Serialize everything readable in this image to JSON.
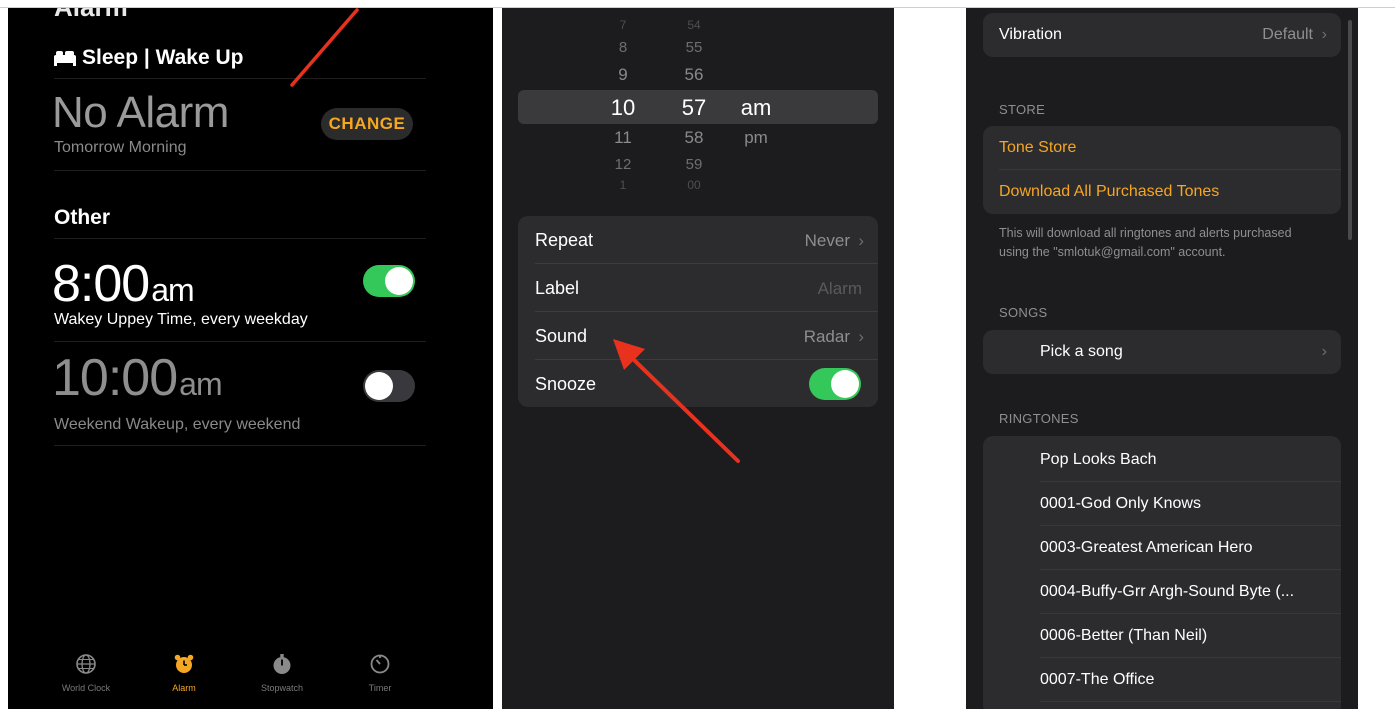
{
  "alarm_screen": {
    "title": "Alarm",
    "sleep_section": {
      "header": "Sleep | Wake Up",
      "status": "No Alarm",
      "subtitle": "Tomorrow Morning",
      "change_label": "CHANGE"
    },
    "other_section": {
      "header": "Other",
      "alarms": [
        {
          "time": "8:00",
          "ampm": "am",
          "label": "Wakey Uppey Time, every weekday",
          "enabled": true
        },
        {
          "time": "10:00",
          "ampm": "am",
          "label": "Weekend Wakeup, every weekend",
          "enabled": false
        }
      ]
    },
    "tabs": [
      {
        "label": "World Clock",
        "icon": "globe-icon",
        "active": false
      },
      {
        "label": "Alarm",
        "icon": "alarm-clock-icon",
        "active": true
      },
      {
        "label": "Stopwatch",
        "icon": "stopwatch-icon",
        "active": false
      },
      {
        "label": "Timer",
        "icon": "timer-icon",
        "active": false
      }
    ]
  },
  "edit_alarm": {
    "picker": {
      "hours": [
        "7",
        "8",
        "9",
        "10",
        "11",
        "12",
        "1"
      ],
      "minutes": [
        "54",
        "55",
        "56",
        "57",
        "58",
        "59",
        "00"
      ],
      "ampm": [
        "am",
        "pm"
      ],
      "selected_hour": "10",
      "selected_minute": "57",
      "selected_ampm": "am"
    },
    "rows": {
      "repeat": {
        "label": "Repeat",
        "value": "Never"
      },
      "label": {
        "label": "Label",
        "placeholder": "Alarm"
      },
      "sound": {
        "label": "Sound",
        "value": "Radar"
      },
      "snooze": {
        "label": "Snooze",
        "enabled": true
      }
    }
  },
  "sound_screen": {
    "vibration": {
      "label": "Vibration",
      "value": "Default"
    },
    "store_header": "STORE",
    "tone_store": "Tone Store",
    "download_all": "Download All Purchased Tones",
    "store_footer": "This will download all ringtones and alerts purchased using the \"smlotuk@gmail.com\" account.",
    "songs_header": "SONGS",
    "pick_song": "Pick a song",
    "ringtones_header": "RINGTONES",
    "ringtones": [
      "Pop Looks Bach",
      "0001-God Only Knows",
      "0003-Greatest American Hero",
      "0004-Buffy-Grr Argh-Sound Byte (...",
      "0006-Better (Than Neil)",
      "0007-The Office"
    ]
  },
  "colors": {
    "accent_orange": "#f5a623",
    "toggle_green": "#34c759",
    "annotation_red": "#e8321e"
  }
}
